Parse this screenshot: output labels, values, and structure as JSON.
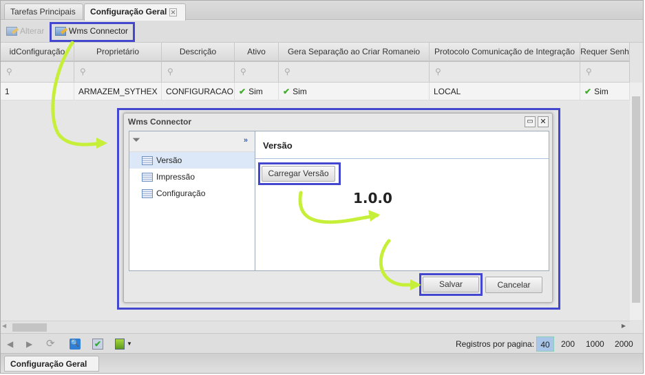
{
  "tabs": [
    {
      "label": "Tarefas Principais"
    },
    {
      "label": "Configuração Geral"
    }
  ],
  "toolbar": {
    "alterar": "Alterar",
    "wms": "Wms Connector"
  },
  "columns": [
    "idConfiguração",
    "Proprietário",
    "Descrição",
    "Ativo",
    "Gera Separação ao Criar Romaneio",
    "Protocolo Comunicação de Integração",
    "Requer Senh"
  ],
  "row": [
    "1",
    "ARMAZEM_SYTHEX",
    "CONFIGURACAO",
    "Sim",
    "Sim",
    "LOCAL",
    "Sim"
  ],
  "dialog": {
    "title": "Wms Connector",
    "nav": [
      "Versão",
      "Impressão",
      "Configuração"
    ],
    "panel_title": "Versão",
    "load_button": "Carregar Versão",
    "version": "1.0.0",
    "save": "Salvar",
    "cancel": "Cancelar"
  },
  "pager": {
    "label": "Registros por pagina:",
    "sizes": [
      "40",
      "200",
      "1000",
      "2000"
    ],
    "selected": "40"
  },
  "bottom_tab": "Configuração Geral",
  "colors": {
    "highlight": "#4346cf",
    "arrow": "#c6ef3a"
  }
}
